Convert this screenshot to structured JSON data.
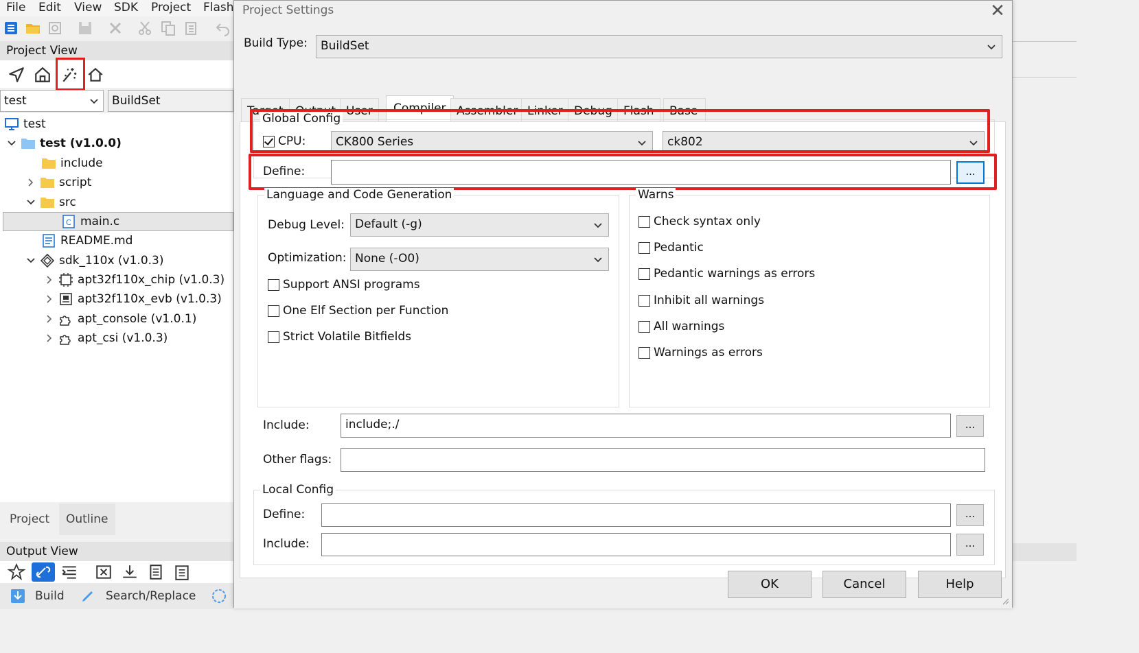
{
  "menu": [
    "File",
    "Edit",
    "View",
    "SDK",
    "Project",
    "Flash"
  ],
  "toolbar_icons": [
    "new-file-icon",
    "open-folder-icon",
    "refresh-icon",
    "save-icon",
    "close-icon",
    "cut-icon",
    "copy-icon",
    "paste-icon",
    "undo-icon"
  ],
  "project_view": {
    "title": "Project View",
    "icons": [
      "navigate-icon",
      "home-build-icon",
      "wizard-icon",
      "house-icon"
    ],
    "project_combo": "test",
    "buildset_combo": "BuildSet",
    "tree": [
      {
        "label": "test",
        "depth": 0
      },
      {
        "label": "test (v1.0.0)",
        "depth": 0
      },
      {
        "label": "include",
        "depth": 1
      },
      {
        "label": "script",
        "depth": 1
      },
      {
        "label": "src",
        "depth": 1
      },
      {
        "label": "main.c",
        "depth": 2
      },
      {
        "label": "README.md",
        "depth": 1
      },
      {
        "label": "sdk_110x (v1.0.3)",
        "depth": 1
      },
      {
        "label": "apt32f110x_chip (v1.0.3)",
        "depth": 2
      },
      {
        "label": "apt32f110x_evb (v1.0.3)",
        "depth": 2
      },
      {
        "label": "apt_console (v1.0.1)",
        "depth": 2
      },
      {
        "label": "apt_csi (v1.0.3)",
        "depth": 2
      }
    ],
    "tabs": [
      "Project",
      "Outline"
    ]
  },
  "output_view": {
    "title": "Output View",
    "tabs": [
      "Build",
      "Search/Replace"
    ]
  },
  "dialog": {
    "title": "Project Settings",
    "build_type_label": "Build Type:",
    "build_type_value": "BuildSet",
    "tabs": [
      "Target",
      "Output",
      "User",
      "Compiler",
      "Assembler",
      "Linker",
      "Debug",
      "Flash",
      "Base"
    ],
    "active_tab": "Compiler",
    "global_config": {
      "title": "Global Config",
      "cpu_label": "CPU:",
      "cpu_checked": true,
      "cpu_series": "CK800 Series",
      "cpu_model": "ck802",
      "define_label": "Define:",
      "define_value": "",
      "browse_label": "..."
    },
    "lang_group": {
      "title": "Language and Code Generation",
      "debug_level_label": "Debug Level:",
      "debug_level_value": "Default (-g)",
      "optimization_label": "Optimization:",
      "optimization_value": "None (-O0)",
      "checks": [
        {
          "label": "Support ANSI programs",
          "checked": false
        },
        {
          "label": "One Elf Section per Function",
          "checked": false
        },
        {
          "label": "Strict Volatile Bitfields",
          "checked": false
        }
      ]
    },
    "warns": {
      "title": "Warns",
      "checks": [
        {
          "label": "Check syntax only",
          "checked": false
        },
        {
          "label": "Pedantic",
          "checked": false
        },
        {
          "label": "Pedantic warnings as errors",
          "checked": false
        },
        {
          "label": "Inhibit all warnings",
          "checked": false
        },
        {
          "label": "All warnings",
          "checked": false
        },
        {
          "label": "Warnings as errors",
          "checked": false
        }
      ]
    },
    "include_label": "Include:",
    "include_value": "include;./",
    "other_flags_label": "Other flags:",
    "other_flags_value": "",
    "local_config": {
      "title": "Local Config",
      "define_label": "Define:",
      "define_value": "",
      "include_label": "Include:",
      "include_value": ""
    },
    "buttons": {
      "ok": "OK",
      "cancel": "Cancel",
      "help": "Help"
    }
  },
  "colors": {
    "highlight_red": "#e0201f",
    "accent_blue": "#0078d7"
  }
}
